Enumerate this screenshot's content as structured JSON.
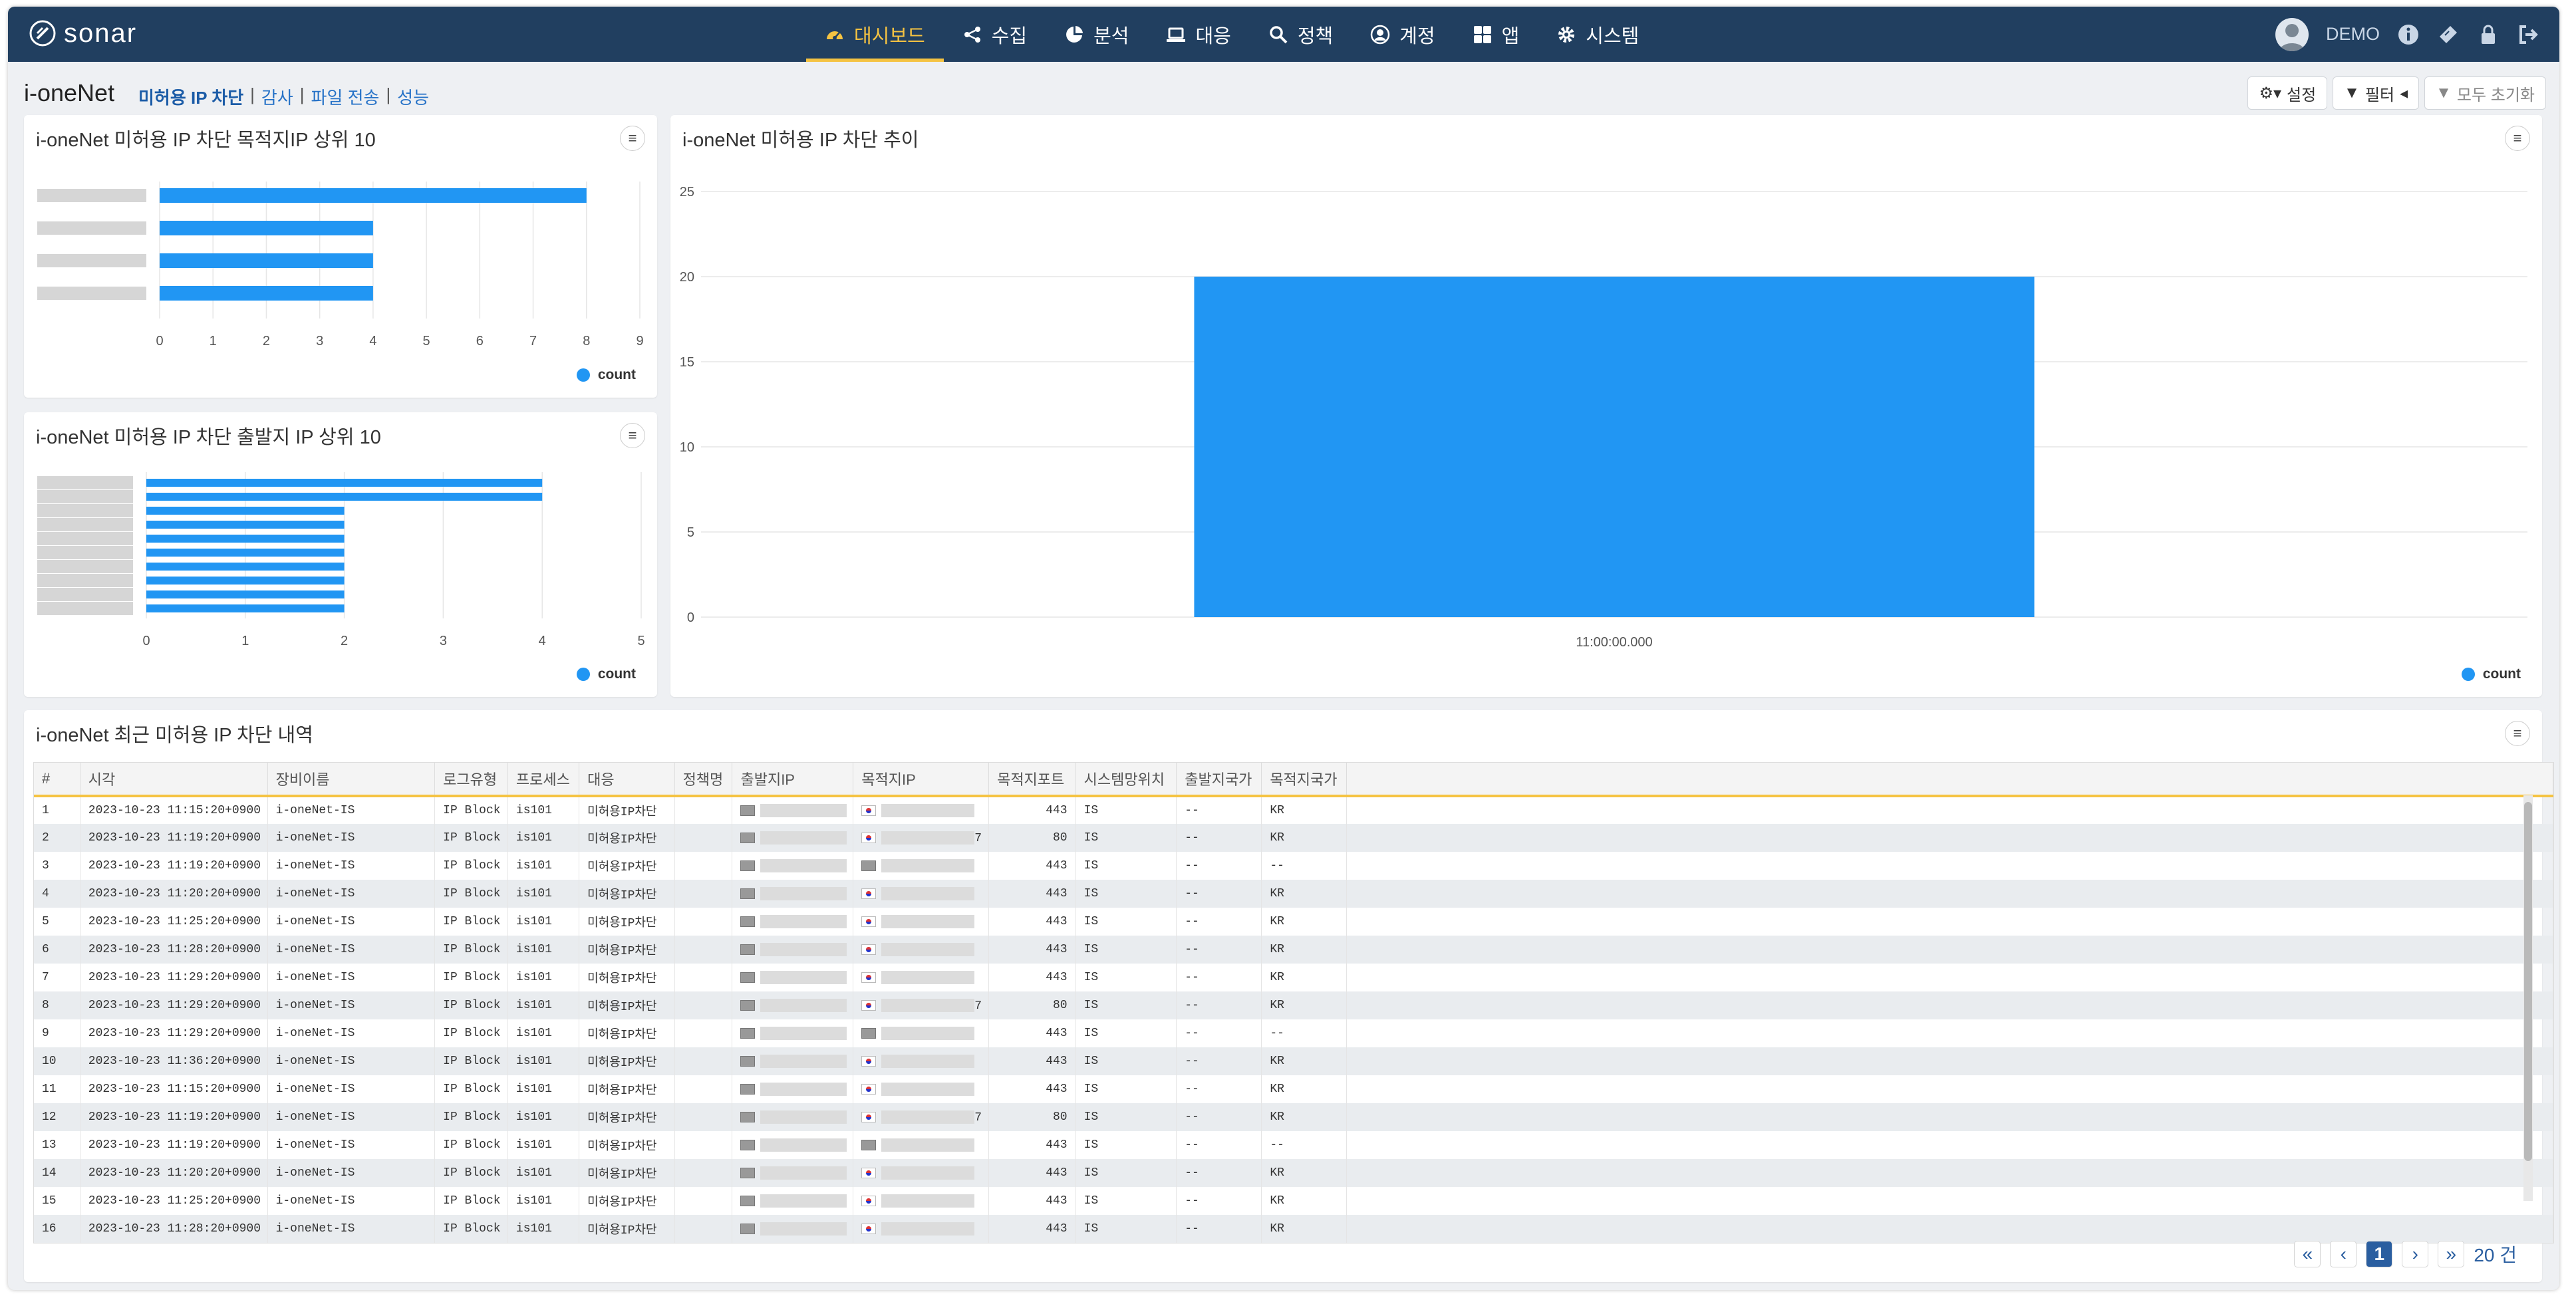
{
  "app": {
    "logo": "sonar"
  },
  "nav": {
    "menus": [
      {
        "label": "대시보드",
        "icon": "dashboard-icon",
        "active": true
      },
      {
        "label": "수집",
        "icon": "share-icon",
        "active": false
      },
      {
        "label": "분석",
        "icon": "pie-chart-icon",
        "active": false
      },
      {
        "label": "대응",
        "icon": "laptop-icon",
        "active": false
      },
      {
        "label": "정책",
        "icon": "search-icon",
        "active": false
      },
      {
        "label": "계정",
        "icon": "user-circle-icon",
        "active": false
      },
      {
        "label": "앱",
        "icon": "grid-icon",
        "active": false
      },
      {
        "label": "시스템",
        "icon": "gear-icon",
        "active": false
      }
    ],
    "user": "DEMO"
  },
  "page": {
    "title": "i-oneNet",
    "breadcrumbs": [
      "미허용 IP 차단",
      "감사",
      "파일 전송",
      "성능"
    ],
    "buttons": {
      "settings": "설정",
      "filter": "필터",
      "reset": "모두 초기화"
    }
  },
  "panels": {
    "dest_top10": {
      "title": "i-oneNet 미허용 IP 차단 목적지IP 상위 10",
      "legend": "count"
    },
    "src_top10": {
      "title": "i-oneNet 미허용 IP 차단 출발지 IP 상위 10",
      "legend": "count"
    },
    "trend": {
      "title": "i-oneNet 미허용 IP 차단 추이",
      "legend": "count"
    },
    "recent": {
      "title": "i-oneNet 최근 미허용 IP 차단 내역"
    }
  },
  "chart_data": [
    {
      "type": "bar",
      "orientation": "horizontal",
      "title": "i-oneNet 미허용 IP 차단 목적지IP 상위 10",
      "categories_masked": true,
      "series": [
        {
          "name": "count",
          "values": [
            8,
            4,
            4,
            4
          ]
        }
      ],
      "xlim": [
        0,
        9
      ],
      "xticks": [
        0,
        1,
        2,
        3,
        4,
        5,
        6,
        7,
        8,
        9
      ],
      "color": "#2196f3",
      "legend": "bottom-right",
      "grid": true
    },
    {
      "type": "bar",
      "orientation": "horizontal",
      "title": "i-oneNet 미허용 IP 차단 출발지 IP 상위 10",
      "categories_masked": true,
      "series": [
        {
          "name": "count",
          "values": [
            4,
            4,
            2,
            2,
            2,
            2,
            2,
            2,
            2,
            2
          ]
        }
      ],
      "xlim": [
        0,
        5
      ],
      "xticks": [
        0,
        1,
        2,
        3,
        4,
        5
      ],
      "color": "#2196f3",
      "legend": "bottom-right",
      "grid": true
    },
    {
      "type": "bar",
      "title": "i-oneNet 미허용 IP 차단 추이",
      "categories": [
        "11:00:00.000"
      ],
      "series": [
        {
          "name": "count",
          "values": [
            20
          ]
        }
      ],
      "ylim": [
        0,
        25
      ],
      "yticks": [
        0,
        5,
        10,
        15,
        20,
        25
      ],
      "color": "#2196f3",
      "legend": "bottom-right",
      "grid": true
    }
  ],
  "table": {
    "columns": [
      "#",
      "시각",
      "장비이름",
      "로그유형",
      "프로세스",
      "대응",
      "정책명",
      "출발지IP",
      "목적지IP",
      "목적지포트",
      "시스템망위치",
      "출발지국가",
      "목적지국가"
    ],
    "rows": [
      {
        "n": "1",
        "time": "2023-10-23 11:15:20+0900",
        "device": "i-oneNet-IS",
        "logtype": "IP Block",
        "process": "is101",
        "action": "미허용IP차단",
        "policy": "",
        "dst_flag": "kr",
        "dst_suffix": "",
        "port": "443",
        "loc": "IS",
        "src_country": "--",
        "dst_country": "KR"
      },
      {
        "n": "2",
        "time": "2023-10-23 11:19:20+0900",
        "device": "i-oneNet-IS",
        "logtype": "IP Block",
        "process": "is101",
        "action": "미허용IP차단",
        "policy": "",
        "dst_flag": "kr",
        "dst_suffix": "7",
        "port": "80",
        "loc": "IS",
        "src_country": "--",
        "dst_country": "KR"
      },
      {
        "n": "3",
        "time": "2023-10-23 11:19:20+0900",
        "device": "i-oneNet-IS",
        "logtype": "IP Block",
        "process": "is101",
        "action": "미허용IP차단",
        "policy": "",
        "dst_flag": "pc",
        "dst_suffix": "",
        "port": "443",
        "loc": "IS",
        "src_country": "--",
        "dst_country": "--"
      },
      {
        "n": "4",
        "time": "2023-10-23 11:20:20+0900",
        "device": "i-oneNet-IS",
        "logtype": "IP Block",
        "process": "is101",
        "action": "미허용IP차단",
        "policy": "",
        "dst_flag": "kr",
        "dst_suffix": "",
        "port": "443",
        "loc": "IS",
        "src_country": "--",
        "dst_country": "KR"
      },
      {
        "n": "5",
        "time": "2023-10-23 11:25:20+0900",
        "device": "i-oneNet-IS",
        "logtype": "IP Block",
        "process": "is101",
        "action": "미허용IP차단",
        "policy": "",
        "dst_flag": "kr",
        "dst_suffix": "",
        "port": "443",
        "loc": "IS",
        "src_country": "--",
        "dst_country": "KR"
      },
      {
        "n": "6",
        "time": "2023-10-23 11:28:20+0900",
        "device": "i-oneNet-IS",
        "logtype": "IP Block",
        "process": "is101",
        "action": "미허용IP차단",
        "policy": "",
        "dst_flag": "kr",
        "dst_suffix": "",
        "port": "443",
        "loc": "IS",
        "src_country": "--",
        "dst_country": "KR"
      },
      {
        "n": "7",
        "time": "2023-10-23 11:29:20+0900",
        "device": "i-oneNet-IS",
        "logtype": "IP Block",
        "process": "is101",
        "action": "미허용IP차단",
        "policy": "",
        "dst_flag": "kr",
        "dst_suffix": "",
        "port": "443",
        "loc": "IS",
        "src_country": "--",
        "dst_country": "KR"
      },
      {
        "n": "8",
        "time": "2023-10-23 11:29:20+0900",
        "device": "i-oneNet-IS",
        "logtype": "IP Block",
        "process": "is101",
        "action": "미허용IP차단",
        "policy": "",
        "dst_flag": "kr",
        "dst_suffix": "7",
        "port": "80",
        "loc": "IS",
        "src_country": "--",
        "dst_country": "KR"
      },
      {
        "n": "9",
        "time": "2023-10-23 11:29:20+0900",
        "device": "i-oneNet-IS",
        "logtype": "IP Block",
        "process": "is101",
        "action": "미허용IP차단",
        "policy": "",
        "dst_flag": "pc",
        "dst_suffix": "",
        "port": "443",
        "loc": "IS",
        "src_country": "--",
        "dst_country": "--"
      },
      {
        "n": "10",
        "time": "2023-10-23 11:36:20+0900",
        "device": "i-oneNet-IS",
        "logtype": "IP Block",
        "process": "is101",
        "action": "미허용IP차단",
        "policy": "",
        "dst_flag": "kr",
        "dst_suffix": "",
        "port": "443",
        "loc": "IS",
        "src_country": "--",
        "dst_country": "KR"
      },
      {
        "n": "11",
        "time": "2023-10-23 11:15:20+0900",
        "device": "i-oneNet-IS",
        "logtype": "IP Block",
        "process": "is101",
        "action": "미허용IP차단",
        "policy": "",
        "dst_flag": "kr",
        "dst_suffix": "",
        "port": "443",
        "loc": "IS",
        "src_country": "--",
        "dst_country": "KR"
      },
      {
        "n": "12",
        "time": "2023-10-23 11:19:20+0900",
        "device": "i-oneNet-IS",
        "logtype": "IP Block",
        "process": "is101",
        "action": "미허용IP차단",
        "policy": "",
        "dst_flag": "kr",
        "dst_suffix": "7",
        "port": "80",
        "loc": "IS",
        "src_country": "--",
        "dst_country": "KR"
      },
      {
        "n": "13",
        "time": "2023-10-23 11:19:20+0900",
        "device": "i-oneNet-IS",
        "logtype": "IP Block",
        "process": "is101",
        "action": "미허용IP차단",
        "policy": "",
        "dst_flag": "pc",
        "dst_suffix": "",
        "port": "443",
        "loc": "IS",
        "src_country": "--",
        "dst_country": "--"
      },
      {
        "n": "14",
        "time": "2023-10-23 11:20:20+0900",
        "device": "i-oneNet-IS",
        "logtype": "IP Block",
        "process": "is101",
        "action": "미허용IP차단",
        "policy": "",
        "dst_flag": "kr",
        "dst_suffix": "",
        "port": "443",
        "loc": "IS",
        "src_country": "--",
        "dst_country": "KR"
      },
      {
        "n": "15",
        "time": "2023-10-23 11:25:20+0900",
        "device": "i-oneNet-IS",
        "logtype": "IP Block",
        "process": "is101",
        "action": "미허용IP차단",
        "policy": "",
        "dst_flag": "kr",
        "dst_suffix": "",
        "port": "443",
        "loc": "IS",
        "src_country": "--",
        "dst_country": "KR"
      },
      {
        "n": "16",
        "time": "2023-10-23 11:28:20+0900",
        "device": "i-oneNet-IS",
        "logtype": "IP Block",
        "process": "is101",
        "action": "미허용IP차단",
        "policy": "",
        "dst_flag": "kr",
        "dst_suffix": "",
        "port": "443",
        "loc": "IS",
        "src_country": "--",
        "dst_country": "KR"
      }
    ]
  },
  "pagination": {
    "first": "«",
    "prev": "‹",
    "current": "1",
    "next": "›",
    "last": "»",
    "total": "20 건"
  }
}
